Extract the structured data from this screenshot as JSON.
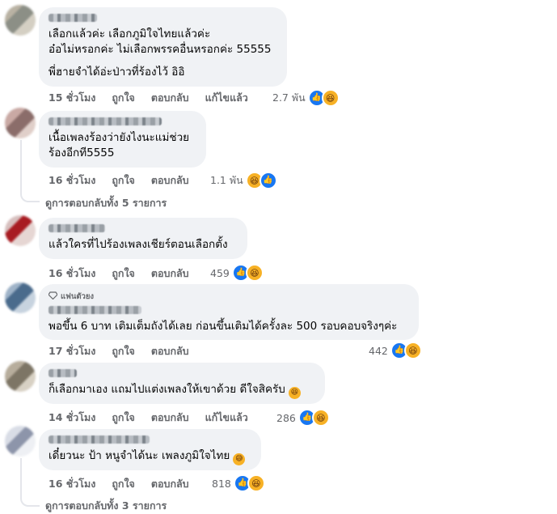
{
  "comments": [
    {
      "lines": [
        "เลือกแล้วค่ะ เลือกภูมิใจไทยแล้วค่ะ",
        "อ๋อไม่หรอกค่ะ ไม่เลือกพรรคอื่นหรอกค่ะ 55555",
        "",
        "พี่ฮายจำได้อ่ะป่าวที่ร้องไว้ อิอิ"
      ],
      "time": "15 ชั่วโมง",
      "like": "ถูกใจ",
      "reply": "ตอบกลับ",
      "edited": "แก้ไขแล้ว",
      "reaction_count": "2.7 พัน",
      "reactions": [
        "like-icon",
        "haha-icon"
      ]
    },
    {
      "lines": [
        "เนื้อเพลงร้องว่ายังไงนะแม่ช่วย",
        "ร้องอีกที5555"
      ],
      "time": "16 ชั่วโมง",
      "like": "ถูกใจ",
      "reply": "ตอบกลับ",
      "reaction_count": "1.1 พัน",
      "reactions": [
        "haha-icon",
        "like-icon"
      ],
      "view_replies": "ดูการตอบกลับทั้ง 5 รายการ"
    },
    {
      "lines": [
        "แล้วใครที่ไปร้องเพลงเชียร์ตอนเลือกตั้ง"
      ],
      "time": "16 ชั่วโมง",
      "like": "ถูกใจ",
      "reply": "ตอบกลับ",
      "reaction_count": "459",
      "reactions": [
        "like-icon",
        "haha-icon"
      ]
    },
    {
      "badge": "แฟนตัวยง",
      "lines": [
        "พอขึ้น 6 บาท เติมเต็มถังได้เลย ก่อนขึ้นเติมได้ครั้งละ 500 รอบคอบจริงๆค่ะ"
      ],
      "time": "17 ชั่วโมง",
      "like": "ถูกใจ",
      "reply": "ตอบกลับ",
      "reaction_count": "442",
      "reactions": [
        "like-icon",
        "haha-icon"
      ]
    },
    {
      "lines": [
        "ก็เลือกมาเอง แถมไปแต่งเพลงให้เขาด้วย ดีใจสิครับ"
      ],
      "inline_emoji": "grin-emoji",
      "time": "14 ชั่วโมง",
      "like": "ถูกใจ",
      "reply": "ตอบกลับ",
      "edited": "แก้ไขแล้ว",
      "reaction_count": "286",
      "reactions": [
        "like-icon",
        "haha-icon"
      ]
    },
    {
      "lines": [
        "เดี๋ยวนะ ป้า หนูจำได้นะ เพลงภูมิใจไทย"
      ],
      "inline_emoji": "sweat-smile-emoji",
      "time": "16 ชั่วโมง",
      "like": "ถูกใจ",
      "reply": "ตอบกลับ",
      "reaction_count": "818",
      "reactions": [
        "like-icon",
        "haha-icon"
      ],
      "view_replies": "ดูการตอบกลับทั้ง 3 รายการ"
    }
  ],
  "colors": {
    "bubble": "#f0f2f5",
    "meta": "#65676b",
    "like_blue": "#1877f2",
    "haha_yellow": "#f7b125"
  }
}
